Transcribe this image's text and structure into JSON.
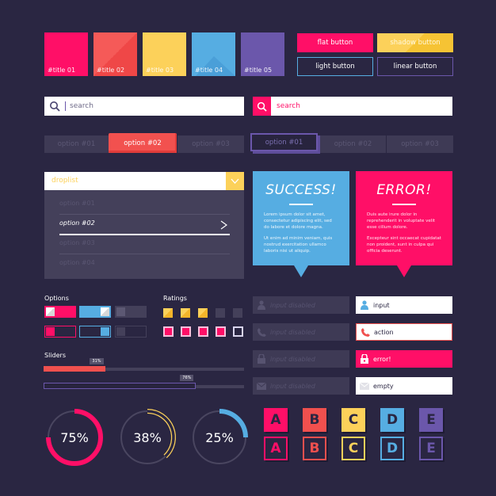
{
  "colors": {
    "background": "#2a2642",
    "pink": "#ff0f67",
    "coral": "#f0504e",
    "yellow": "#fcd15a",
    "blue": "#56ade2",
    "purple": "#6b57ab"
  },
  "tiles": [
    {
      "label": "#title 01",
      "color": "#ff0f67"
    },
    {
      "label": "#title 02",
      "color": "#f0504e"
    },
    {
      "label": "#title 03",
      "color": "#fcd15a"
    },
    {
      "label": "#title 04",
      "color": "#56ade2"
    },
    {
      "label": "#title 05",
      "color": "#6b57ab"
    }
  ],
  "buttons": {
    "flat": "flat button",
    "shadow": "shadow button",
    "light": "light button",
    "linear": "linear button"
  },
  "search": {
    "left_placeholder": "search",
    "right_placeholder": "search"
  },
  "tabs_left": {
    "items": [
      "option #01",
      "option #02",
      "option #03"
    ],
    "active_index": 1
  },
  "tabs_right": {
    "items": [
      "option #01",
      "option #02",
      "option #03"
    ],
    "active_index": 0
  },
  "droplist": {
    "label": "droplist",
    "options": [
      "option #01",
      "option #02",
      "option #03",
      "option #04"
    ],
    "selected_index": 1
  },
  "alerts": {
    "success": {
      "title": "SUCCESS!",
      "p1": "Lorem ipsum dolor sit amet, consectetur adipiscing elit, sed do labore et dolore magna.",
      "p2": "Ut enim ad minim veniam, quis nostrud exercitation ullamco laboris nisi ut aliquip."
    },
    "error": {
      "title": "ERROR!",
      "p1": "Duis aute irure dolor in reprehenderit in voluptate velit esse cillum dolore.",
      "p2": "Excepteur sint occaecat cupidatat non proident, sunt in culpa qui officia deserunt."
    }
  },
  "options_label": "Options",
  "ratings_label": "Ratings",
  "ratings": {
    "stars_filled": 3,
    "stars_total": 5,
    "boxes_filled": 4,
    "boxes_total": 5
  },
  "sliders_label": "Sliders",
  "sliders": [
    {
      "value_label": "31%",
      "value": 31
    },
    {
      "value_label": "76%",
      "value": 76
    }
  ],
  "inputs": {
    "disabled": [
      "input disabled",
      "input disabled",
      "input disabled",
      "input disabled"
    ],
    "active": [
      {
        "label": "input",
        "icon": "user-icon"
      },
      {
        "label": "action",
        "icon": "phone-icon"
      },
      {
        "label": "error!",
        "icon": "lock-icon"
      },
      {
        "label": "empty",
        "icon": "mail-icon"
      }
    ]
  },
  "progress": [
    {
      "label": "75%",
      "value": 75,
      "color": "#ff0f67"
    },
    {
      "label": "38%",
      "value": 38,
      "color": "#fcd15a"
    },
    {
      "label": "25%",
      "value": 25,
      "color": "#56ade2"
    }
  ],
  "letters": [
    "A",
    "B",
    "C",
    "D",
    "E"
  ]
}
